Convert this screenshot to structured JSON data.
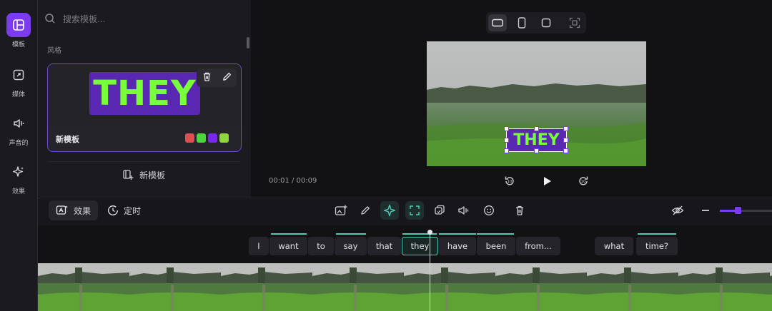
{
  "sidebar": {
    "items": [
      {
        "label": "模板",
        "icon": "templates-icon",
        "active": true
      },
      {
        "label": "媒体",
        "icon": "media-icon",
        "active": false
      },
      {
        "label": "声音的",
        "icon": "audio-icon",
        "active": false
      },
      {
        "label": "效果",
        "icon": "effects-icon",
        "active": false
      }
    ]
  },
  "panel": {
    "search_placeholder": "搜索模板...",
    "section_title": "风格",
    "template_card": {
      "preview_text": "THEY",
      "name": "新模板",
      "swatches": [
        "#e04f4f",
        "#4bd63a",
        "#7a28f0",
        "#8fd63a"
      ]
    },
    "new_template_label": "新模板"
  },
  "preview": {
    "aspect_options": [
      "landscape-icon",
      "portrait-icon",
      "square-icon",
      "fit-icon"
    ],
    "overlay_text": "THEY",
    "time_display": "00:01 / 00:09",
    "controls": [
      "rewind-10-icon",
      "play-icon",
      "forward-10-icon"
    ]
  },
  "toolbar": {
    "tabs": [
      {
        "label": "效果",
        "active": true
      },
      {
        "label": "定时",
        "active": false
      }
    ],
    "zoom_level": 0.35
  },
  "transcript": {
    "words": [
      "I",
      "want",
      "to",
      "say",
      "that",
      "they",
      "have",
      "been",
      "from...",
      "what",
      "time?"
    ],
    "selected_word": "they"
  },
  "colors": {
    "accent": "#7b3cf0",
    "text_green": "#79ff3a",
    "highlight_teal": "#4fc9b3"
  }
}
